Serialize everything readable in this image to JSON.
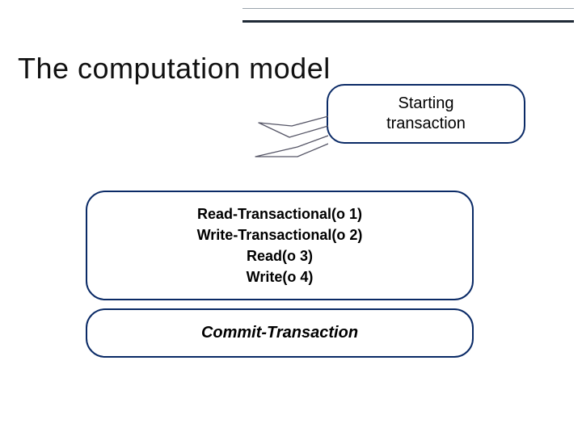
{
  "title": "The computation model",
  "callout_line1": "Starting",
  "callout_line2": "transaction",
  "ops_box": {
    "line1": "Read-Transactional(o 1)",
    "line2": "Write-Transactional(o 2)",
    "line3": "Read(o 3)",
    "line4": "Write(o 4)"
  },
  "commit_box": "Commit-Transaction",
  "colors": {
    "outline": "#0a2a66",
    "rule_light": "#9aa4ad",
    "rule_dark": "#1f2a36"
  }
}
